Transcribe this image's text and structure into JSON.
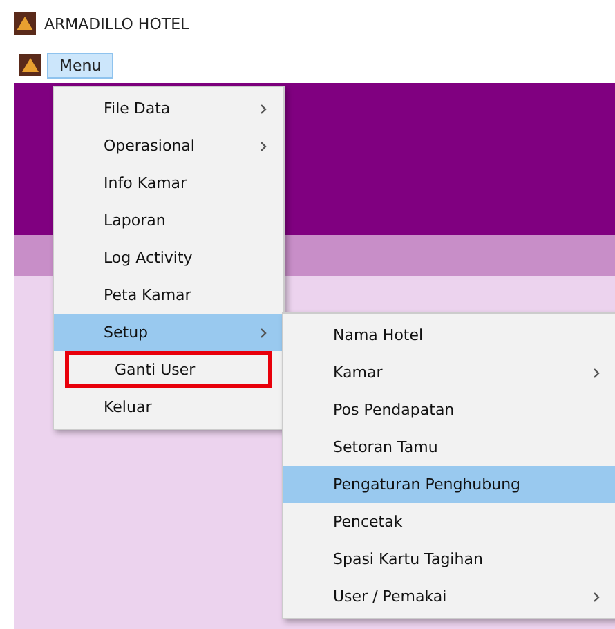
{
  "window": {
    "title": "ARMADILLO HOTEL"
  },
  "menubar": [
    {
      "label": "Menu",
      "selected": true
    }
  ],
  "menu": [
    {
      "label": "File Data",
      "submenu": true,
      "selected": false,
      "outlined": false
    },
    {
      "label": "Operasional",
      "submenu": true,
      "selected": false,
      "outlined": false
    },
    {
      "label": "Info Kamar",
      "submenu": false,
      "selected": false,
      "outlined": false
    },
    {
      "label": "Laporan",
      "submenu": false,
      "selected": false,
      "outlined": false
    },
    {
      "label": "Log Activity",
      "submenu": false,
      "selected": false,
      "outlined": false
    },
    {
      "label": "Peta Kamar",
      "submenu": false,
      "selected": false,
      "outlined": false
    },
    {
      "label": "Setup",
      "submenu": true,
      "selected": true,
      "outlined": false
    },
    {
      "label": "Ganti User",
      "submenu": false,
      "selected": false,
      "outlined": true
    },
    {
      "label": "Keluar",
      "submenu": false,
      "selected": false,
      "outlined": false
    }
  ],
  "submenu": [
    {
      "label": "Nama Hotel",
      "submenu": false,
      "selected": false
    },
    {
      "label": "Kamar",
      "submenu": true,
      "selected": false
    },
    {
      "label": "Pos Pendapatan",
      "submenu": false,
      "selected": false
    },
    {
      "label": "Setoran Tamu",
      "submenu": false,
      "selected": false
    },
    {
      "label": "Pengaturan Penghubung",
      "submenu": false,
      "selected": true
    },
    {
      "label": "Pencetak",
      "submenu": false,
      "selected": false
    },
    {
      "label": "Spasi Kartu Tagihan",
      "submenu": false,
      "selected": false
    },
    {
      "label": "User / Pemakai",
      "submenu": true,
      "selected": false
    }
  ]
}
